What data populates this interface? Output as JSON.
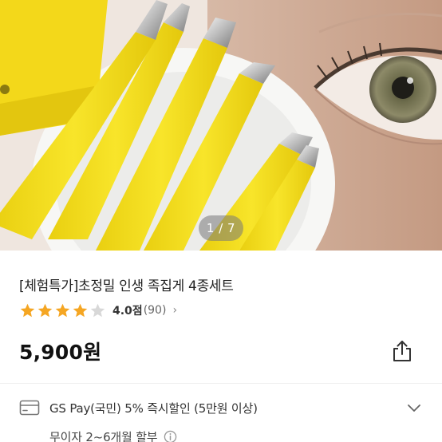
{
  "hero": {
    "image_counter": "1 / 7",
    "image_description_icon": "product-photo-yellow-tweezers"
  },
  "product": {
    "title": "[체험특가]초정밀 인생 족집게 4종세트",
    "rating": {
      "stars_filled": 4,
      "stars_total": 5,
      "score_text": "4.0점",
      "count_text": "(90)",
      "chevron": "›"
    },
    "price": "5,900원"
  },
  "benefits": {
    "card_benefit": "GS Pay(국민) 5% 즉시할인 (5만원 이상)",
    "installment": "무이자 2~6개월 할부"
  },
  "colors": {
    "star": "#f5a623",
    "star_empty": "#d8d8d8",
    "tweezer_yellow": "#f5df1e"
  }
}
